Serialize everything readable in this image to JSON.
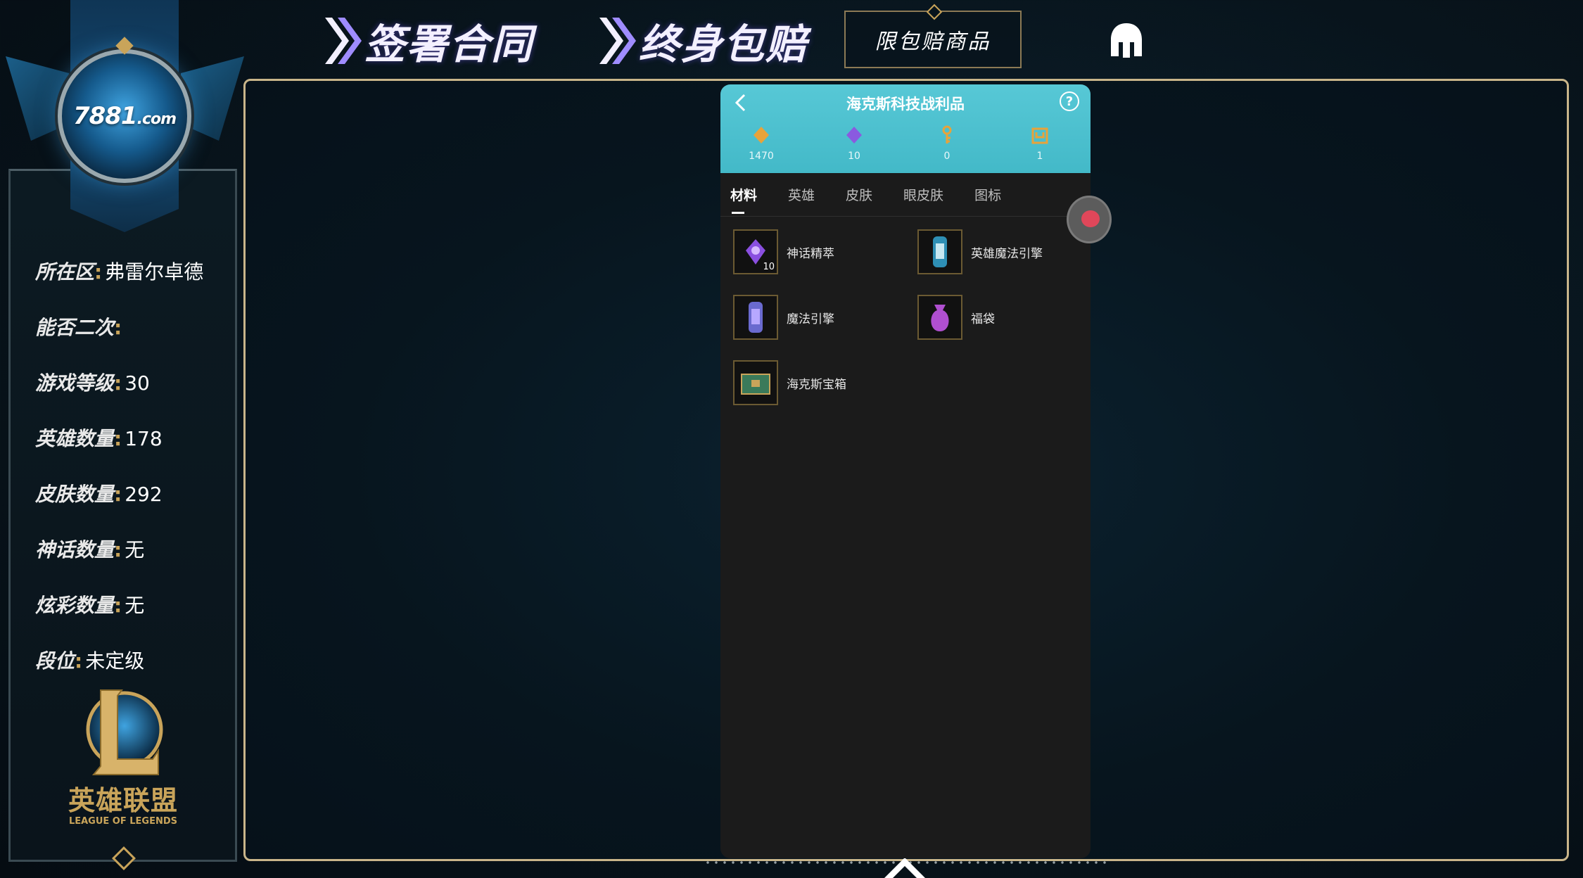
{
  "header": {
    "title1": "签署合同",
    "title2": "终身包赔",
    "badge": "限包赔商品",
    "helmet_icon": "helmet-icon"
  },
  "left_panel": {
    "logo_text": "7881",
    "logo_suffix": ".com",
    "rows": [
      {
        "key": "所在区",
        "value": "弗雷尔卓德"
      },
      {
        "key": "能否二次",
        "value": ""
      },
      {
        "key": "游戏等级",
        "value": "30"
      },
      {
        "key": "英雄数量",
        "value": "178"
      },
      {
        "key": "皮肤数量",
        "value": "292"
      },
      {
        "key": "神话数量",
        "value": "无"
      },
      {
        "key": "炫彩数量",
        "value": "无"
      },
      {
        "key": "段位",
        "value": "未定级"
      }
    ],
    "lol_cn": "英雄联盟",
    "lol_en": "LEAGUE OF LEGENDS",
    "lol_en_of": "of"
  },
  "phone": {
    "title": "海克斯科技战利品",
    "help": "?",
    "currencies": [
      {
        "icon": "orange-essence-icon",
        "value": "1470",
        "color": "#e8a33a"
      },
      {
        "icon": "purple-essence-icon",
        "value": "10",
        "color": "#8a5ae0"
      },
      {
        "icon": "key-icon",
        "value": "0",
        "color": "#e8a33a"
      },
      {
        "icon": "chest-icon",
        "value": "1",
        "color": "#e8a33a"
      }
    ],
    "tabs": [
      "材料",
      "英雄",
      "皮肤",
      "眼皮肤",
      "图标"
    ],
    "items": [
      {
        "label": "神话精萃",
        "count": "10",
        "icon": "mythic-essence-icon",
        "color": "#8a4fe0"
      },
      {
        "label": "英雄魔法引擎",
        "count": "",
        "icon": "champion-engine-icon",
        "color": "#2e8fb5"
      },
      {
        "label": "魔法引擎",
        "count": "",
        "icon": "magic-engine-icon",
        "color": "#6a6acf"
      },
      {
        "label": "福袋",
        "count": "",
        "icon": "lucky-bag-icon",
        "color": "#b04fd0"
      },
      {
        "label": "海克斯宝箱",
        "count": "",
        "icon": "hextech-chest-icon",
        "color": "#3a7a5a"
      }
    ]
  }
}
